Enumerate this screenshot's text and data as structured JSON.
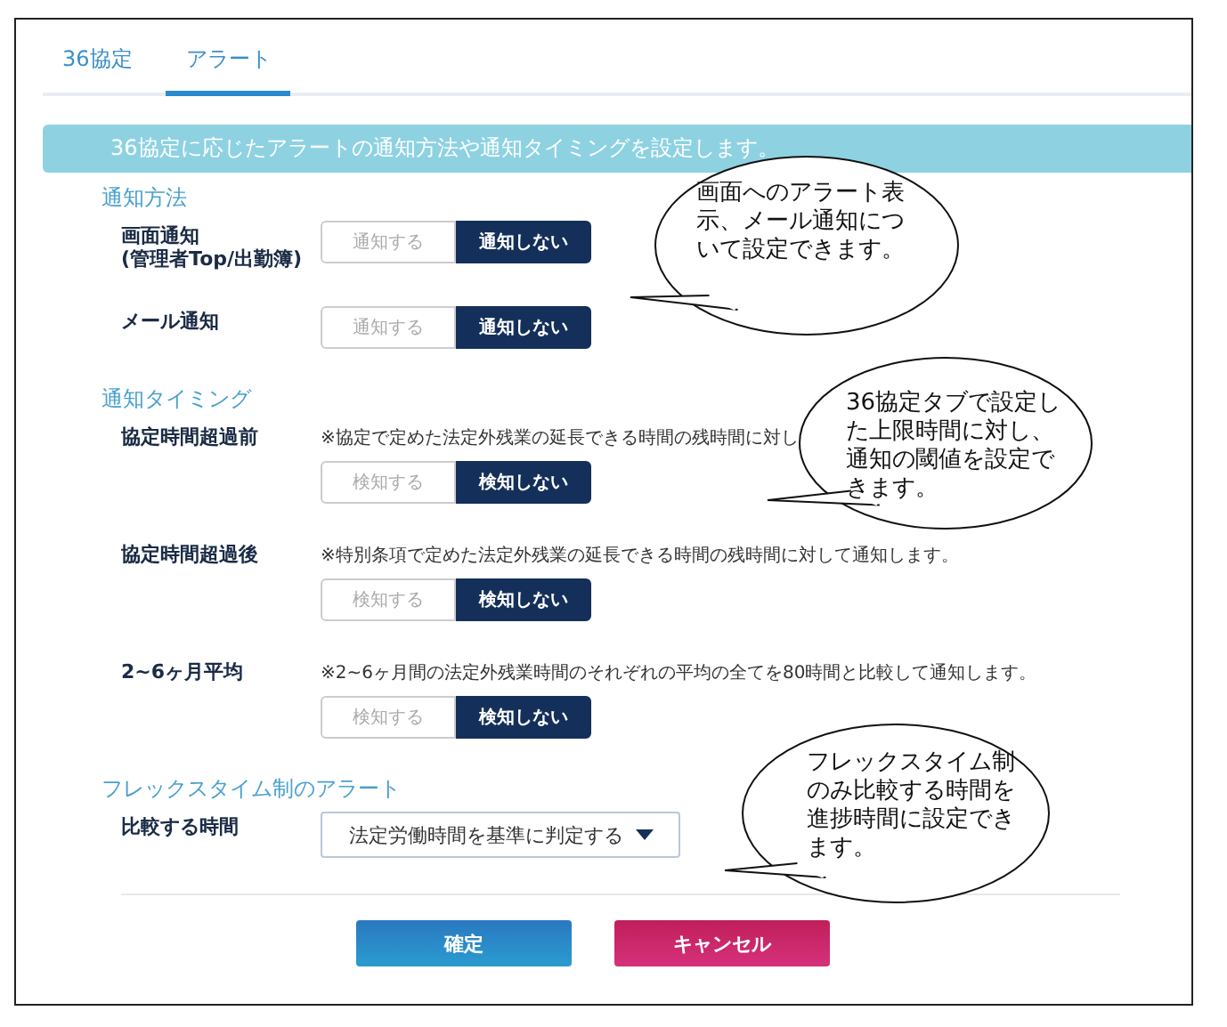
{
  "tabs": [
    {
      "label": "36協定",
      "selected": false
    },
    {
      "label": "アラート",
      "selected": true
    }
  ],
  "banner": "36協定に応じたアラートの通知方法や通知タイミングを設定します。",
  "sections": [
    {
      "title": "通知方法",
      "rows": [
        {
          "kind": "toggle",
          "label": "画面通知\n(管理者Top/出勤簿)",
          "options": [
            {
              "label": "通知する",
              "selected": false
            },
            {
              "label": "通知しない",
              "selected": true
            }
          ]
        },
        {
          "kind": "toggle",
          "label": "メール通知",
          "options": [
            {
              "label": "通知する",
              "selected": false
            },
            {
              "label": "通知しない",
              "selected": true
            }
          ]
        }
      ]
    },
    {
      "title": "通知タイミング",
      "rows": [
        {
          "kind": "toggle",
          "label": "協定時間超過前",
          "note": "※協定で定めた法定外残業の延長できる時間の残時間に対し",
          "options": [
            {
              "label": "検知する",
              "selected": false
            },
            {
              "label": "検知しない",
              "selected": true
            }
          ]
        },
        {
          "kind": "toggle",
          "label": "協定時間超過後",
          "note": "※特別条項で定めた法定外残業の延長できる時間の残時間に対して通知します。",
          "options": [
            {
              "label": "検知する",
              "selected": false
            },
            {
              "label": "検知しない",
              "selected": true
            }
          ]
        },
        {
          "kind": "toggle",
          "label": "2~6ヶ月平均",
          "note": "※2~6ヶ月間の法定外残業時間のそれぞれの平均の全てを80時間と比較して通知します。",
          "options": [
            {
              "label": "検知する",
              "selected": false
            },
            {
              "label": "検知しない",
              "selected": true
            }
          ]
        }
      ]
    },
    {
      "title": "フレックスタイム制のアラート",
      "rows": [
        {
          "kind": "select",
          "label": "比較する時間",
          "value": "法定労働時間を基準に判定する"
        }
      ]
    }
  ],
  "buttons": [
    {
      "kind": "primary",
      "label": "確定"
    },
    {
      "kind": "danger",
      "label": "キャンセル"
    }
  ],
  "callouts": [
    {
      "text": "画面へのアラート表示、メール通知について設定できます。"
    },
    {
      "text": "36協定タブで設定した上限時間に対し、通知の閾値を設定できます。"
    },
    {
      "text": "フレックスタイム制のみ比較する時間を進捗時間に設定できます。"
    }
  ]
}
